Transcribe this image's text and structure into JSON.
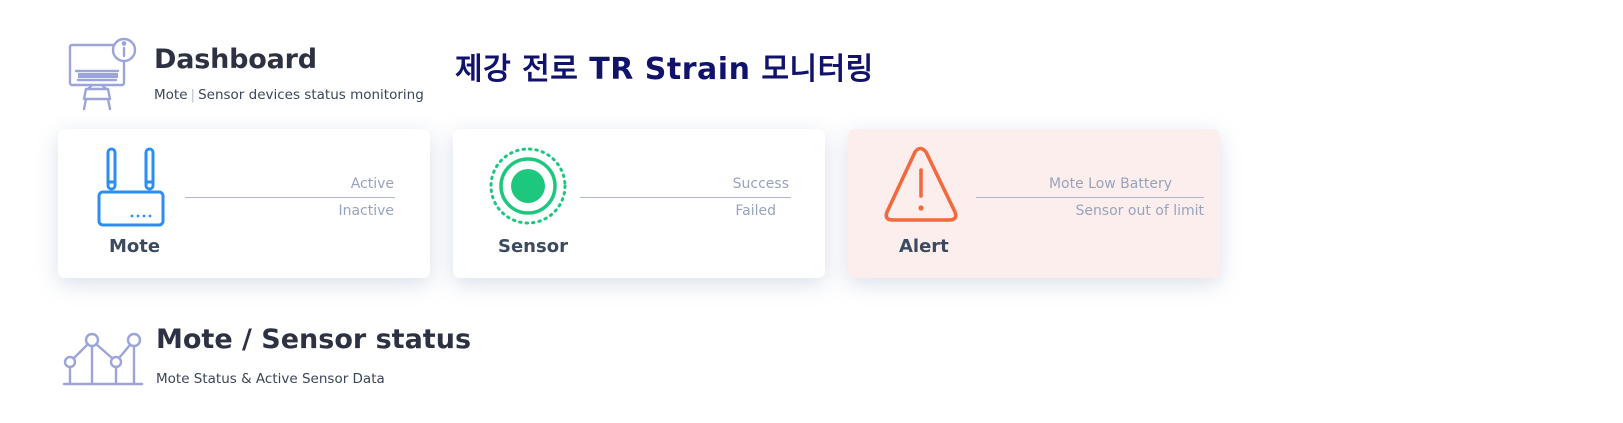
{
  "header": {
    "title": "Dashboard",
    "subtitle_left": "Mote",
    "subtitle_right": "Sensor devices status monitoring",
    "page_title": "제강 전로 TR Strain 모니터링"
  },
  "cards": {
    "mote": {
      "name": "Mote",
      "label_top": "Active",
      "label_bottom": "Inactive",
      "icon": "router-icon",
      "color": "#2b8ef0"
    },
    "sensor": {
      "name": "Sensor",
      "label_top": "Success",
      "label_bottom": "Failed",
      "icon": "sensor-dot-icon",
      "color": "#1ec77e"
    },
    "alert": {
      "name": "Alert",
      "label_top": "Mote Low Battery",
      "label_bottom": "Sensor out of limit",
      "icon": "warning-triangle-icon",
      "color": "#f26a3b"
    }
  },
  "status_section": {
    "title": "Mote / Sensor status",
    "subtitle": "Mote Status & Active Sensor Data",
    "icon": "line-chart-icon"
  },
  "colors": {
    "icon_outline": "#9ca5d9",
    "korean_title": "#10126b",
    "alert_background": "#fdeeee"
  }
}
